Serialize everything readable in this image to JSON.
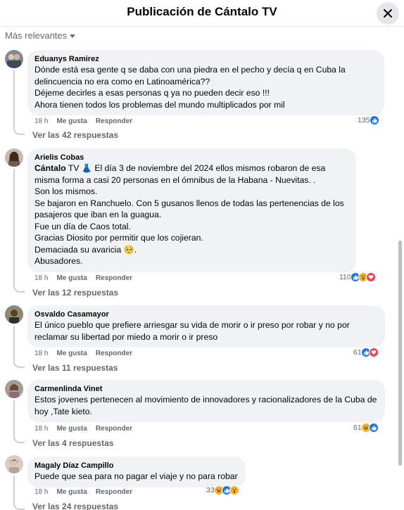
{
  "header": {
    "title": "Publicación de Cántalo TV"
  },
  "sort": {
    "label": "Más relevantes"
  },
  "comments": [
    {
      "author": "Eduanys Ramirez",
      "lines": [
        "Dónde está esa gente q se daba con una piedra en el pecho y decía q en Cuba la delincuencia no era como en Latinoamérica??",
        "Déjeme decirles a esas personas q ya no pueden decir eso !!!",
        "Ahora tienen todos los problemas del mundo multiplicados por mil"
      ],
      "time": "18 h",
      "like": "Me gusta",
      "reply": "Responder",
      "reaction_count": "135",
      "replies_link": "Ver las 42 respuestas"
    },
    {
      "author": "Arielis Cobas",
      "mention": "Cántalo",
      "mention_rest": " TV 👗 El día 3 de noviembre del 2024 ellos mismos robaron de esa misma forma a casi 20 personas en el ómnibus de la Habana - Nuevitas. .",
      "lines": [
        "Son los mismos.",
        "Se bajaron en Ranchuelo. Con 5 gusanos llenos de todas las pertenencias de los pasajeros que iban en la guagua.",
        "Fue un día de Caos total.",
        "Gracias Diosito por permitir que los cojieran.",
        "Demaciada su avaricia 🥺.",
        "Abusadores."
      ],
      "time": "18 h",
      "like": "Me gusta",
      "reply": "Responder",
      "reaction_count": "110",
      "replies_link": "Ver las 12 respuestas"
    },
    {
      "author": "Osvaldo Casamayor",
      "lines": [
        "El único pueblo que prefiere arriesgar su vida de morir o ir preso por robar y no por reclamar su libertad por miedo a morir o ir preso"
      ],
      "time": "18 h",
      "like": "Me gusta",
      "reply": "Responder",
      "reaction_count": "61",
      "replies_link": "Ver las 11 respuestas"
    },
    {
      "author": "Carmenlinda Vinet",
      "lines": [
        "Estos jovenes pertenecen al movimiento de innovadores y racionalizadores de la Cuba de hoy ,Tate kieto."
      ],
      "time": "18 h",
      "like": "Me gusta",
      "reply": "Responder",
      "reaction_count": "61",
      "replies_link": "Ver las 4 respuestas"
    },
    {
      "author": "Magaly Díaz Campillo",
      "lines": [
        "Puede que sea para no pagar el viaje y no para robar"
      ],
      "time": "18 h",
      "like": "Me gusta",
      "reply": "Responder",
      "reaction_count": "33",
      "replies_link": "Ver las 24 respuestas"
    }
  ],
  "colors": {
    "like": "#1877f2",
    "love": "#f33e58",
    "wow": "#f7b125",
    "bubble": "#f0f2f5",
    "muted": "#65676b"
  },
  "icons": {
    "close": "close-icon",
    "sort": "chevron-down-icon"
  }
}
